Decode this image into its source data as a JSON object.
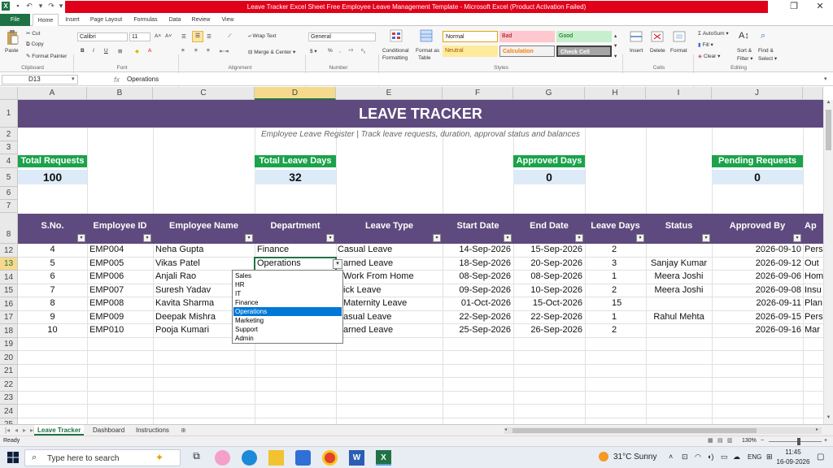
{
  "window": {
    "title": "Leave Tracker Excel Sheet Free Employee Leave Management Template  -  Microsoft Excel (Product Activation Failed)"
  },
  "ribbon_tabs": [
    "File",
    "Home",
    "Insert",
    "Page Layout",
    "Formulas",
    "Data",
    "Review",
    "View"
  ],
  "ribbon": {
    "clipboard": {
      "paste": "Paste",
      "cut": "Cut",
      "copy": "Copy",
      "format_painter": "Format Painter",
      "label": "Clipboard"
    },
    "font": {
      "name": "Calibri",
      "size": "11",
      "label": "Font"
    },
    "alignment": {
      "wrap": "Wrap Text",
      "merge": "Merge & Center",
      "label": "Alignment"
    },
    "number": {
      "format": "General",
      "label": "Number"
    },
    "styles": {
      "conditional": "Conditional",
      "conditional2": "Formatting",
      "format_table": "Format as",
      "format_table2": "Table",
      "normal": "Normal",
      "bad": "Bad",
      "good": "Good",
      "neutral": "Neutral",
      "calculation": "Calculation",
      "check_cell": "Check Cell",
      "label": "Styles"
    },
    "cells": {
      "insert": "Insert",
      "delete": "Delete",
      "format": "Format",
      "label": "Cells"
    },
    "editing": {
      "autosum": "AutoSum",
      "fill": "Fill",
      "clear": "Clear",
      "sort": "Sort &",
      "sort2": "Filter",
      "find": "Find &",
      "find2": "Select",
      "label": "Editing"
    }
  },
  "formula_bar": {
    "name_box": "D13",
    "fx": "fx",
    "content": "Operations"
  },
  "columns": [
    "A",
    "B",
    "C",
    "D",
    "E",
    "F",
    "G",
    "H",
    "I",
    "J"
  ],
  "row_numbers": [
    "1",
    "2",
    "3",
    "4",
    "5",
    "6",
    "7",
    "8",
    "12",
    "13",
    "14",
    "15",
    "16",
    "17",
    "18",
    "19",
    "20",
    "21",
    "22",
    "23",
    "24",
    "25"
  ],
  "sheet": {
    "title": "LEAVE TRACKER",
    "subtitle": "Employee Leave Register | Track leave requests, duration, approval status and balances",
    "kpis": [
      {
        "label": "Total Requests",
        "value": "100"
      },
      {
        "label": "Total Leave Days",
        "value": "32"
      },
      {
        "label": "Approved Days",
        "value": "0"
      },
      {
        "label": "Pending Requests",
        "value": "0"
      }
    ],
    "headers": [
      "S.No.",
      "Employee ID",
      "Employee Name",
      "Department",
      "Leave Type",
      "Start Date",
      "End Date",
      "Leave Days",
      "Status",
      "Approved By",
      "Ap"
    ],
    "rows": [
      {
        "sno": "4",
        "id": "EMP004",
        "name": "Neha Gupta",
        "dept": "Finance",
        "type": "Casual Leave",
        "start": "14-Sep-2026",
        "end": "15-Sep-2026",
        "days": "2",
        "status": "",
        "approved": "2026-09-10",
        "extra": "Pers"
      },
      {
        "sno": "5",
        "id": "EMP005",
        "name": "Vikas Patel",
        "dept": "Operations",
        "type": "arned Leave",
        "start": "18-Sep-2026",
        "end": "20-Sep-2026",
        "days": "3",
        "status": "Sanjay Kumar",
        "approved": "2026-09-12",
        "extra": "Out"
      },
      {
        "sno": "6",
        "id": "EMP006",
        "name": "Anjali Rao",
        "dept": "",
        "type": "Work From Home",
        "start": "08-Sep-2026",
        "end": "08-Sep-2026",
        "days": "1",
        "status": "Meera Joshi",
        "approved": "2026-09-06",
        "extra": "Hom"
      },
      {
        "sno": "7",
        "id": "EMP007",
        "name": "Suresh Yadav",
        "dept": "",
        "type": "ick Leave",
        "start": "09-Sep-2026",
        "end": "10-Sep-2026",
        "days": "2",
        "status": "Meera Joshi",
        "approved": "2026-09-08",
        "extra": "Insu"
      },
      {
        "sno": "8",
        "id": "EMP008",
        "name": "Kavita Sharma",
        "dept": "",
        "type": "Maternity Leave",
        "start": "01-Oct-2026",
        "end": "15-Oct-2026",
        "days": "15",
        "status": "",
        "approved": "2026-09-11",
        "extra": "Plan"
      },
      {
        "sno": "9",
        "id": "EMP009",
        "name": "Deepak Mishra",
        "dept": "",
        "type": "asual Leave",
        "start": "22-Sep-2026",
        "end": "22-Sep-2026",
        "days": "1",
        "status": "Rahul Mehta",
        "approved": "2026-09-15",
        "extra": "Pers"
      },
      {
        "sno": "10",
        "id": "EMP010",
        "name": "Pooja Kumari",
        "dept": "",
        "type": "arned Leave",
        "start": "25-Sep-2026",
        "end": "26-Sep-2026",
        "days": "2",
        "status": "",
        "approved": "2026-09-16",
        "extra": "Mar"
      }
    ]
  },
  "dropdown": {
    "options": [
      "Sales",
      "HR",
      "IT",
      "Finance",
      "Operations",
      "Marketing",
      "Support",
      "Admin"
    ],
    "selected": "Operations"
  },
  "sheet_tabs": [
    "Leave Tracker",
    "Dashboard",
    "Instructions"
  ],
  "status": {
    "left": "Ready",
    "zoom": "130%"
  },
  "taskbar": {
    "search": "Type here to search",
    "weather": "31°C  Sunny",
    "lang": "ENG",
    "time": "11:45",
    "date": "16-09-2026"
  },
  "colors": {
    "header_bg": "#5e4a7e",
    "kpi_green": "#1aa34a",
    "kpi_value_bg": "#dcebf7",
    "excel_green": "#1f7246",
    "title_red": "#e0001a",
    "selection": "#0078d7"
  }
}
